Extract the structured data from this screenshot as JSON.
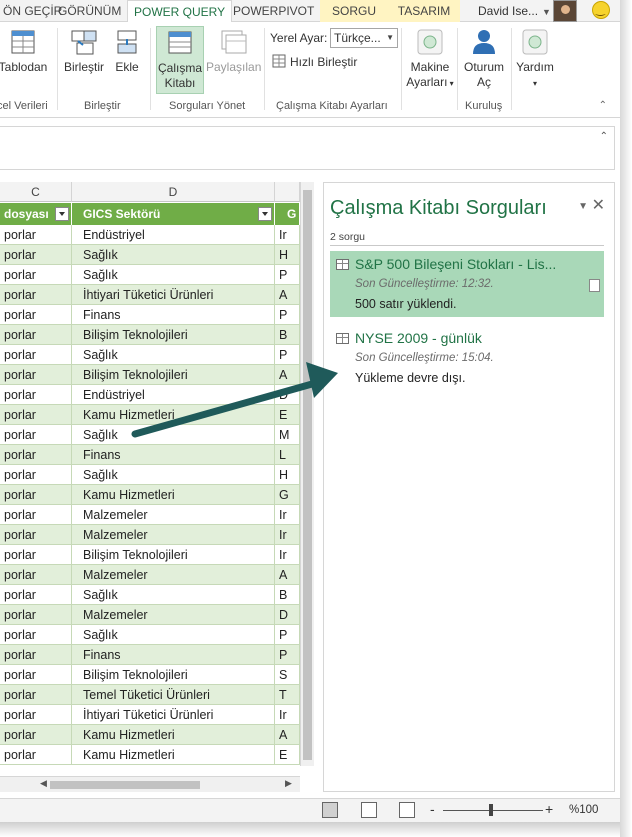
{
  "tabs": {
    "items": [
      {
        "label": "ÖN GEÇİR"
      },
      {
        "label": "GÖRÜNÜM"
      },
      {
        "label": "POWER QUERY"
      },
      {
        "label": "POWERPIVOT"
      },
      {
        "label": "SORGU"
      },
      {
        "label": "TASARIM"
      }
    ],
    "active_index": 2,
    "user_name": "David Ise...",
    "accent_color": "#217346"
  },
  "ribbon": {
    "tablodan": "Tablodan",
    "excel_group": "cel Verileri",
    "birlestir": "Birleştir",
    "ekle": "Ekle",
    "combine_group": "Birleştir",
    "calisma_line1": "Çalışma",
    "calisma_line2": "Kitabı",
    "paylasilan": "Paylaşılan",
    "manage_group": "Sorguları Yönet",
    "locale_label": "Yerel Ayar:",
    "locale_value": "Türkçe...",
    "quick_combine": "Hızlı Birleştir",
    "workbook_group": "Çalışma Kitabı Ayarları",
    "machine_line1": "Makine",
    "machine_line2": "Ayarları",
    "signin_line1": "Oturum",
    "signin_line2": "Aç",
    "setup_group": "Kuruluş",
    "help": "Yardım"
  },
  "grid": {
    "column_letters": [
      "C",
      "D"
    ],
    "headers": [
      "dosyası",
      "GICS Sektörü",
      "G"
    ],
    "rows": [
      {
        "c": "porlar",
        "d": "Endüstriyel",
        "e": "Ir"
      },
      {
        "c": "porlar",
        "d": "Sağlık",
        "e": "H"
      },
      {
        "c": "porlar",
        "d": "Sağlık",
        "e": "P"
      },
      {
        "c": "porlar",
        "d": "İhtiyari Tüketici Ürünleri",
        "e": "A"
      },
      {
        "c": "porlar",
        "d": "Finans",
        "e": "P"
      },
      {
        "c": "porlar",
        "d": "Bilişim Teknolojileri",
        "e": "B"
      },
      {
        "c": "porlar",
        "d": "Sağlık",
        "e": "P"
      },
      {
        "c": "porlar",
        "d": "Bilişim Teknolojileri",
        "e": "A"
      },
      {
        "c": "porlar",
        "d": "Endüstriyel",
        "e": "D"
      },
      {
        "c": "porlar",
        "d": "Kamu Hizmetleri",
        "e": "E"
      },
      {
        "c": "porlar",
        "d": "Sağlık",
        "e": "M"
      },
      {
        "c": "porlar",
        "d": "Finans",
        "e": "L"
      },
      {
        "c": "porlar",
        "d": "Sağlık",
        "e": "H"
      },
      {
        "c": "porlar",
        "d": "Kamu Hizmetleri",
        "e": "G"
      },
      {
        "c": "porlar",
        "d": "Malzemeler",
        "e": "Ir"
      },
      {
        "c": "porlar",
        "d": "Malzemeler",
        "e": "Ir"
      },
      {
        "c": "porlar",
        "d": "Bilişim Teknolojileri",
        "e": "Ir"
      },
      {
        "c": "porlar",
        "d": "Malzemeler",
        "e": "A"
      },
      {
        "c": "porlar",
        "d": "Sağlık",
        "e": "B"
      },
      {
        "c": "porlar",
        "d": "Malzemeler",
        "e": "D"
      },
      {
        "c": "porlar",
        "d": "Sağlık",
        "e": "P"
      },
      {
        "c": "porlar",
        "d": "Finans",
        "e": "P"
      },
      {
        "c": "porlar",
        "d": "Bilişim Teknolojileri",
        "e": "S"
      },
      {
        "c": "porlar",
        "d": "Temel Tüketici Ürünleri",
        "e": "T"
      },
      {
        "c": "porlar",
        "d": "İhtiyari Tüketici Ürünleri",
        "e": "Ir"
      },
      {
        "c": "porlar",
        "d": "Kamu Hizmetleri",
        "e": "A"
      },
      {
        "c": "porlar",
        "d": "Kamu Hizmetleri",
        "e": "E"
      }
    ]
  },
  "pane": {
    "title": "Çalışma Kitabı Sorguları",
    "count": "2 sorgu",
    "queries": [
      {
        "name": "S&P 500 Bileşeni Stokları - Lis...",
        "time": "Son Güncelleştirme: 12:32.",
        "status": "500 satır yüklendi.",
        "selected": true
      },
      {
        "name": "NYSE 2009 - günlük",
        "time": "Son Güncelleştirme: 15:04.",
        "status": "Yükleme devre dışı.",
        "selected": false
      }
    ]
  },
  "statusbar": {
    "zoom_minus": "-",
    "zoom_plus": "+",
    "zoom": "%100",
    "zoom_level": 1.0
  }
}
